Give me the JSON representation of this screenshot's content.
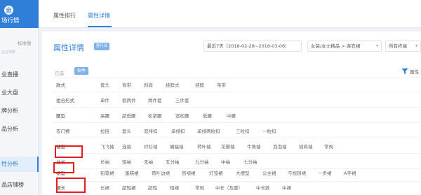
{
  "sidebar": {
    "brand_icon": "bank-icon",
    "brand_title": "场行情",
    "view_mode_a": " ",
    "view_mode_b": "标准版",
    "section_hint": "企业洞察",
    "items": [
      {
        "label": "业直播",
        "active": false
      },
      {
        "label": "业大盘",
        "active": false
      },
      {
        "label": "牌分析",
        "active": false
      },
      {
        "label": "品分析",
        "active": false
      },
      {
        "label": "性分析",
        "active": true
      },
      {
        "label": "品店铺榜",
        "active": false
      }
    ]
  },
  "topbar": {
    "tabs": [
      {
        "label": "属性排行",
        "active": false
      },
      {
        "label": "属性详情",
        "active": true
      }
    ]
  },
  "panel": {
    "title": "属性详情",
    "badge": "查行业",
    "date_range": "最近7天（2018-02-28~2018-03-06）",
    "category": "女装/女士精品 > 连衣裙",
    "terminal": "所有终端",
    "chosen_label": "已选",
    "chosen_tag": "秋季",
    "attr_more": "属性",
    "filter_icon": "filter-icon",
    "rows": [
      {
        "label": "款式",
        "options": [
          "套头",
          "背带",
          "斜肩",
          "挂脖式",
          "挂脖",
          "吊带"
        ]
      },
      {
        "label": "组合形式",
        "options": [
          "单件",
          "假两件",
          "两件套",
          "三件套"
        ]
      },
      {
        "label": "腰型",
        "options": [
          "高腰",
          "超低腰",
          "松紧腰",
          "宽松腰",
          "低腰",
          "中腰"
        ]
      },
      {
        "label": "衣门襟",
        "options": [
          "拉链",
          "套头",
          "双排扣",
          "单排扣",
          "单排两粒扣",
          "三粒扣",
          "一粒扣"
        ]
      },
      {
        "label": "袖型",
        "options": [
          "飞飞袖",
          "连袖",
          "衬衫袖",
          "蝙蝠袖",
          "荷叶袖",
          "花瓣袖",
          "牛角袖",
          "泡泡袖",
          "插肩袖",
          "常规"
        ]
      },
      {
        "label": "袖长",
        "options": [
          "长袖",
          "短袖",
          "无袖",
          "五分袖",
          "九分袖",
          "中袖",
          "七分袖"
        ]
      },
      {
        "label": "裙型",
        "options": [
          "铅笔裙",
          "蛋糕裙",
          "荷叶边裙",
          "百褶裙",
          "灯笼裙",
          "大摆型",
          "公主裙",
          "不规则裙",
          "一步裙",
          "A字裙"
        ]
      },
      {
        "label": "裙长",
        "options": [
          "长裙",
          "超短裙",
          "超短",
          "短裙",
          "常规",
          "中长（及膝）",
          "中长款",
          "中裙"
        ]
      }
    ]
  }
}
